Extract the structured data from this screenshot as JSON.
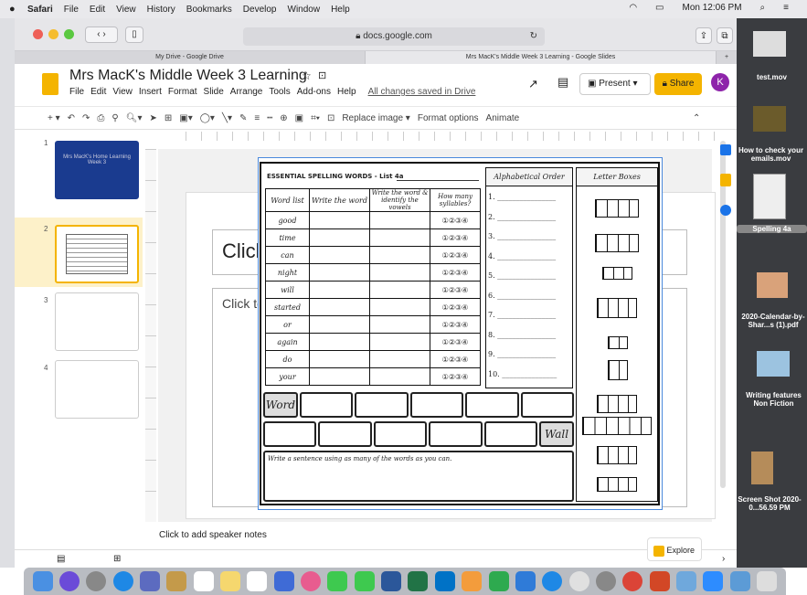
{
  "menubar": {
    "app": "Safari",
    "items": [
      "File",
      "Edit",
      "View",
      "History",
      "Bookmarks",
      "Develop",
      "Window",
      "Help"
    ],
    "clock": "Mon 12:06 PM"
  },
  "browser": {
    "address": "docs.google.com",
    "tabs": [
      "My Drive - Google Drive",
      "Mrs MacK's Middle Week 3 Learning - Google Slides"
    ]
  },
  "doc": {
    "title": "Mrs MacK's Middle Week 3 Learning",
    "menu": [
      "File",
      "Edit",
      "View",
      "Insert",
      "Format",
      "Slide",
      "Arrange",
      "Tools",
      "Add-ons",
      "Help"
    ],
    "saved": "All changes saved in Drive",
    "present": "Present",
    "share": "Share",
    "avatar": "K"
  },
  "gtoolbar": {
    "replace": "Replace image ▾",
    "format": "Format options",
    "animate": "Animate"
  },
  "slides": {
    "numbers": [
      "1",
      "2",
      "3",
      "4"
    ],
    "thumb1": "Mrs MacK's Home Learning Week 3"
  },
  "slide": {
    "click_title": "Click t",
    "click_body": "Click to a"
  },
  "worksheet": {
    "title": "ESSENTIAL SPELLING WORDS - List 4a",
    "headers": [
      "Word list",
      "Write the word",
      "Write the word & identify the vowels",
      "How many syllables?"
    ],
    "words": [
      "good",
      "time",
      "can",
      "night",
      "will",
      "started",
      "or",
      "again",
      "do",
      "your"
    ],
    "syllables": "①②③④",
    "alpha_title": "Alphabetical Order",
    "alpha_nums": [
      "1.",
      "2.",
      "3.",
      "4.",
      "5.",
      "6.",
      "7.",
      "8.",
      "9.",
      "10."
    ],
    "boxes_title": "Letter Boxes",
    "word_label": "Word",
    "wall_label": "Wall",
    "sentence": "Write a sentence using as many of the words as you can."
  },
  "notes": "Click to add speaker notes",
  "explore": "Explore",
  "desktop_files": [
    "test.mov",
    "How to check your emails.mov",
    "Spelling 4a",
    "2020-Calendar-by-Shar...s (1).pdf",
    "Writing features Non Fiction",
    "Screen Shot 2020-0...56.59 PM"
  ]
}
